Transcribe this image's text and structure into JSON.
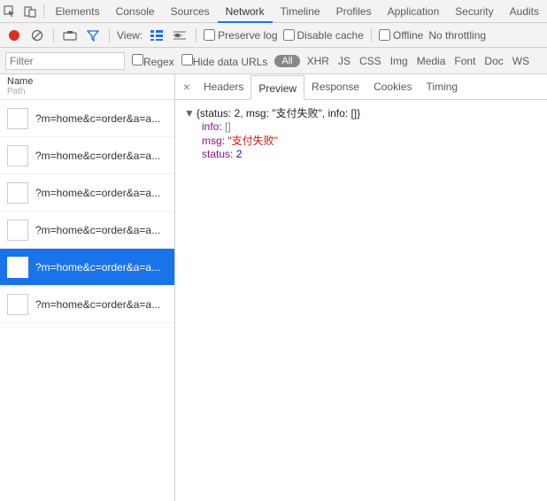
{
  "topTabs": {
    "items": [
      "Elements",
      "Console",
      "Sources",
      "Network",
      "Timeline",
      "Profiles",
      "Application",
      "Security",
      "Audits"
    ],
    "activeIndex": 3
  },
  "toolbar": {
    "viewLabel": "View:",
    "preserveLog": "Preserve log",
    "disableCache": "Disable cache",
    "offline": "Offline",
    "throttling": "No throttling"
  },
  "filterbar": {
    "placeholder": "Filter",
    "regex": "Regex",
    "hideData": "Hide data URLs",
    "all": "All",
    "types": [
      "XHR",
      "JS",
      "CSS",
      "Img",
      "Media",
      "Font",
      "Doc",
      "WS"
    ]
  },
  "leftHeader": {
    "name": "Name",
    "path": "Path"
  },
  "requests": [
    {
      "label": "?m=home&c=order&a=a...",
      "selected": false
    },
    {
      "label": "?m=home&c=order&a=a...",
      "selected": false
    },
    {
      "label": "?m=home&c=order&a=a...",
      "selected": false
    },
    {
      "label": "?m=home&c=order&a=a...",
      "selected": false
    },
    {
      "label": "?m=home&c=order&a=a...",
      "selected": true
    },
    {
      "label": "?m=home&c=order&a=a...",
      "selected": false
    }
  ],
  "subTabs": {
    "items": [
      "Headers",
      "Preview",
      "Response",
      "Cookies",
      "Timing"
    ],
    "activeIndex": 1
  },
  "response": {
    "summary": "{status: 2, msg: \"支付失败\", info: []}",
    "info": {
      "key": "info",
      "value": "[]"
    },
    "msg": {
      "key": "msg",
      "value": "\"支付失败\""
    },
    "status": {
      "key": "status",
      "value": "2"
    }
  }
}
